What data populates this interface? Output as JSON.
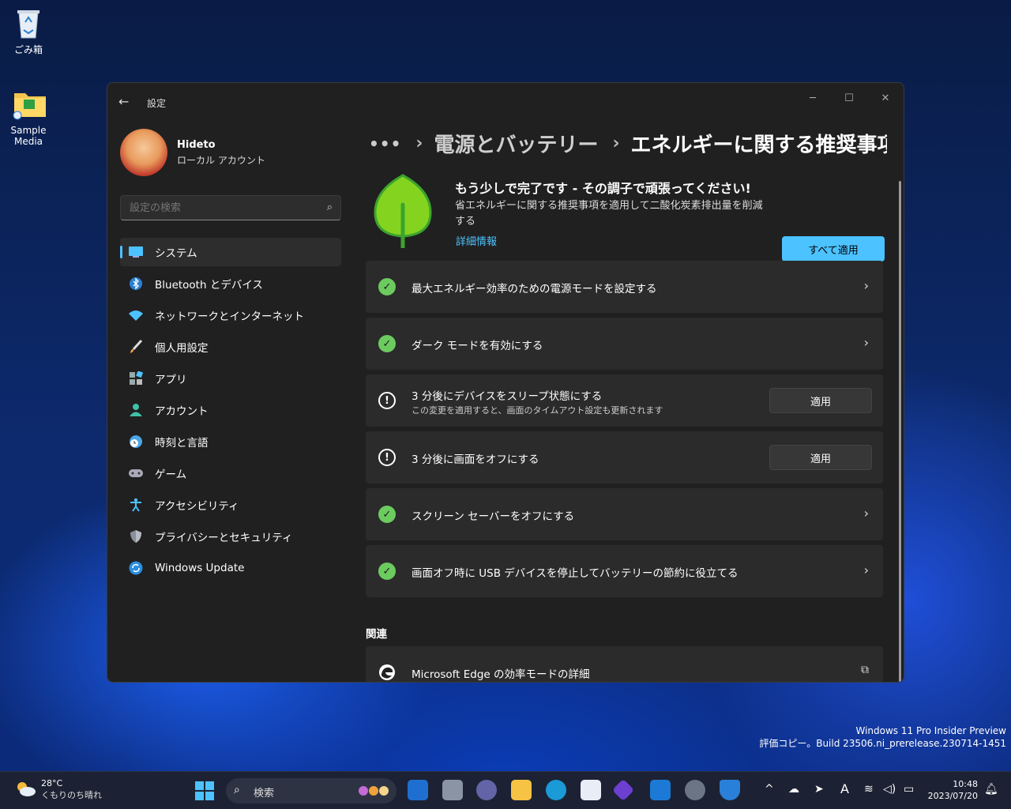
{
  "desktop": {
    "recycle_bin": "ごみ箱",
    "sample_media": "Sample Media"
  },
  "window": {
    "title": "設定",
    "minimize": "─",
    "maximize": "☐",
    "close": "✕"
  },
  "profile": {
    "name": "Hideto",
    "account_type": "ローカル アカウント"
  },
  "search": {
    "placeholder": "設定の検索"
  },
  "nav": {
    "items": [
      {
        "label": "システム",
        "icon": "monitor-icon"
      },
      {
        "label": "Bluetooth とデバイス",
        "icon": "bluetooth-icon"
      },
      {
        "label": "ネットワークとインターネット",
        "icon": "wifi-icon"
      },
      {
        "label": "個人用設定",
        "icon": "brush-icon"
      },
      {
        "label": "アプリ",
        "icon": "apps-icon"
      },
      {
        "label": "アカウント",
        "icon": "person-icon"
      },
      {
        "label": "時刻と言語",
        "icon": "clock-globe-icon"
      },
      {
        "label": "ゲーム",
        "icon": "gamepad-icon"
      },
      {
        "label": "アクセシビリティ",
        "icon": "accessibility-icon"
      },
      {
        "label": "プライバシーとセキュリティ",
        "icon": "shield-icon"
      },
      {
        "label": "Windows Update",
        "icon": "update-icon"
      }
    ]
  },
  "breadcrumb": {
    "ellipsis": "•••",
    "parent": "電源とバッテリー",
    "current": "エネルギーに関する推奨事項"
  },
  "hero": {
    "headline": "もう少しで完了です - その調子で頑張ってください!",
    "description": "省エネルギーに関する推奨事項を適用して二酸化炭素排出量を削減する",
    "link": "詳細情報",
    "apply_all": "すべて適用"
  },
  "recommendations": [
    {
      "title": "最大エネルギー効率のための電源モードを設定する",
      "status": "done"
    },
    {
      "title": "ダーク モードを有効にする",
      "status": "done"
    },
    {
      "title": "3 分後にデバイスをスリープ状態にする",
      "subtitle": "この変更を適用すると、画面のタイムアウト設定も更新されます",
      "status": "pending",
      "action": "適用"
    },
    {
      "title": "3 分後に画面をオフにする",
      "status": "pending",
      "action": "適用"
    },
    {
      "title": "スクリーン セーバーをオフにする",
      "status": "done"
    },
    {
      "title": "画面オフ時に USB デバイスを停止してバッテリーの節約に役立てる",
      "status": "done"
    }
  ],
  "related": {
    "heading": "関連",
    "items": [
      {
        "title": "Microsoft Edge の効率モードの詳細"
      }
    ]
  },
  "watermark": {
    "line1": "Windows 11 Pro Insider Preview",
    "line2": "評価コピー。Build 23506.ni_prerelease.230714-1451"
  },
  "taskbar": {
    "weather_temp": "28°C",
    "weather_desc": "くもりのち晴れ",
    "search_label": "検索",
    "time": "10:48",
    "date": "2023/07/20",
    "ime": "A"
  },
  "colors": {
    "accent": "#4cc2ff",
    "done": "#6ccb5f",
    "window_bg": "#202020",
    "card_bg": "#2b2b2b"
  }
}
